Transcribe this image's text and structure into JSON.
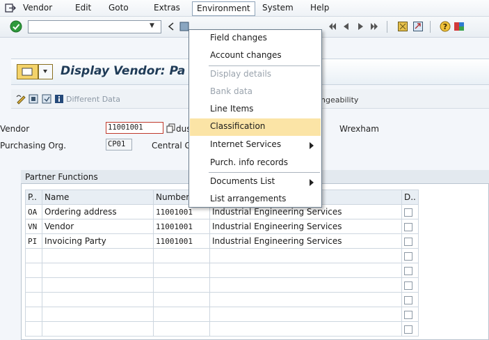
{
  "menubar": {
    "items": [
      {
        "label": "Vendor"
      },
      {
        "label": "Edit"
      },
      {
        "label": "Goto"
      },
      {
        "label": "Extras"
      },
      {
        "label": "Environment"
      },
      {
        "label": "System"
      },
      {
        "label": "Help"
      }
    ]
  },
  "screen": {
    "title": "Display Vendor: Pa",
    "app_toolbar_label": "Different Data",
    "app_toolbar_right": "ngeability"
  },
  "form": {
    "vendor_label": "Vendor",
    "vendor_value": "11001001",
    "vendor_desc_fragment": "dus",
    "city": "Wrexham",
    "purch_org_label": "Purchasing Org.",
    "purch_org_value": "CP01",
    "purch_org_desc_fragment": "Central G"
  },
  "partner_functions": {
    "title": "Partner Functions",
    "columns": [
      "P..",
      "Name",
      "Number",
      "",
      "D.."
    ],
    "rows": [
      {
        "pf": "OA",
        "name": "Ordering address",
        "number": "11001001",
        "desc": "Industrial Engineering Services"
      },
      {
        "pf": "VN",
        "name": "Vendor",
        "number": "11001001",
        "desc": "Industrial Engineering Services"
      },
      {
        "pf": "PI",
        "name": "Invoicing Party",
        "number": "11001001",
        "desc": "Industrial Engineering Services"
      },
      {
        "pf": "",
        "name": "",
        "number": "",
        "desc": ""
      },
      {
        "pf": "",
        "name": "",
        "number": "",
        "desc": ""
      },
      {
        "pf": "",
        "name": "",
        "number": "",
        "desc": ""
      },
      {
        "pf": "",
        "name": "",
        "number": "",
        "desc": ""
      },
      {
        "pf": "",
        "name": "",
        "number": "",
        "desc": ""
      },
      {
        "pf": "",
        "name": "",
        "number": "",
        "desc": ""
      }
    ]
  },
  "environment_menu": {
    "items": [
      {
        "label": "Field changes",
        "state": "enabled"
      },
      {
        "label": "Account changes",
        "state": "enabled"
      },
      {
        "label": "Display details",
        "state": "disabled"
      },
      {
        "label": "Bank data",
        "state": "disabled"
      },
      {
        "label": "Line Items",
        "state": "enabled"
      },
      {
        "label": "Classification",
        "state": "highlighted"
      },
      {
        "label": "Internet Services",
        "state": "enabled",
        "submenu": true
      },
      {
        "label": "Purch. info records",
        "state": "enabled"
      },
      {
        "label": "Documents List",
        "state": "enabled",
        "submenu": true
      },
      {
        "label": "List arrangements",
        "state": "enabled"
      }
    ]
  },
  "colors": {
    "highlight": "#fbe4a6",
    "title_text": "#1f3b57",
    "disabled_text": "#9aa3ad"
  }
}
